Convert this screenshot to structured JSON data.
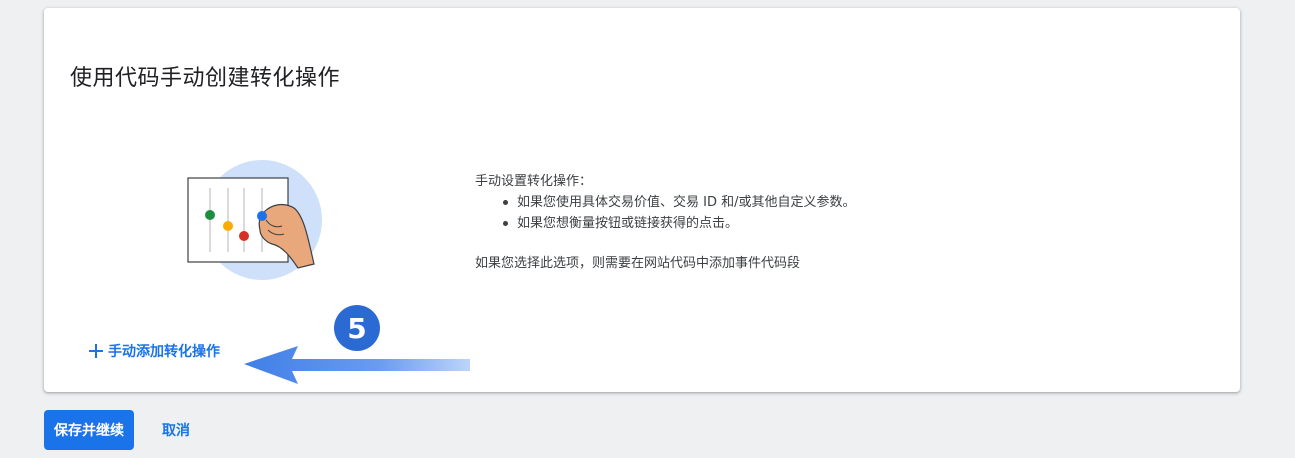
{
  "card": {
    "title": "使用代码手动创建转化操作",
    "description": {
      "intro": "手动设置转化操作：",
      "bullets": [
        "如果您使用具体交易价值、交易 ID 和/或其他自定义参数。",
        "如果您想衡量按钮或链接获得的点击。"
      ],
      "note": "如果您选择此选项，则需要在网站代码中添加事件代码段"
    },
    "add_link_label": "手动添加转化操作",
    "add_link_icon": "plus-icon",
    "illustration_icon": "sliders-hand-illustration"
  },
  "annotation": {
    "step_number": "5",
    "badge_color": "#2b6ad3",
    "arrow_color": "#4a86e8"
  },
  "footer": {
    "save_label": "保存并继续",
    "cancel_label": "取消"
  },
  "colors": {
    "accent": "#1a73e8",
    "background": "#eef0f2"
  }
}
